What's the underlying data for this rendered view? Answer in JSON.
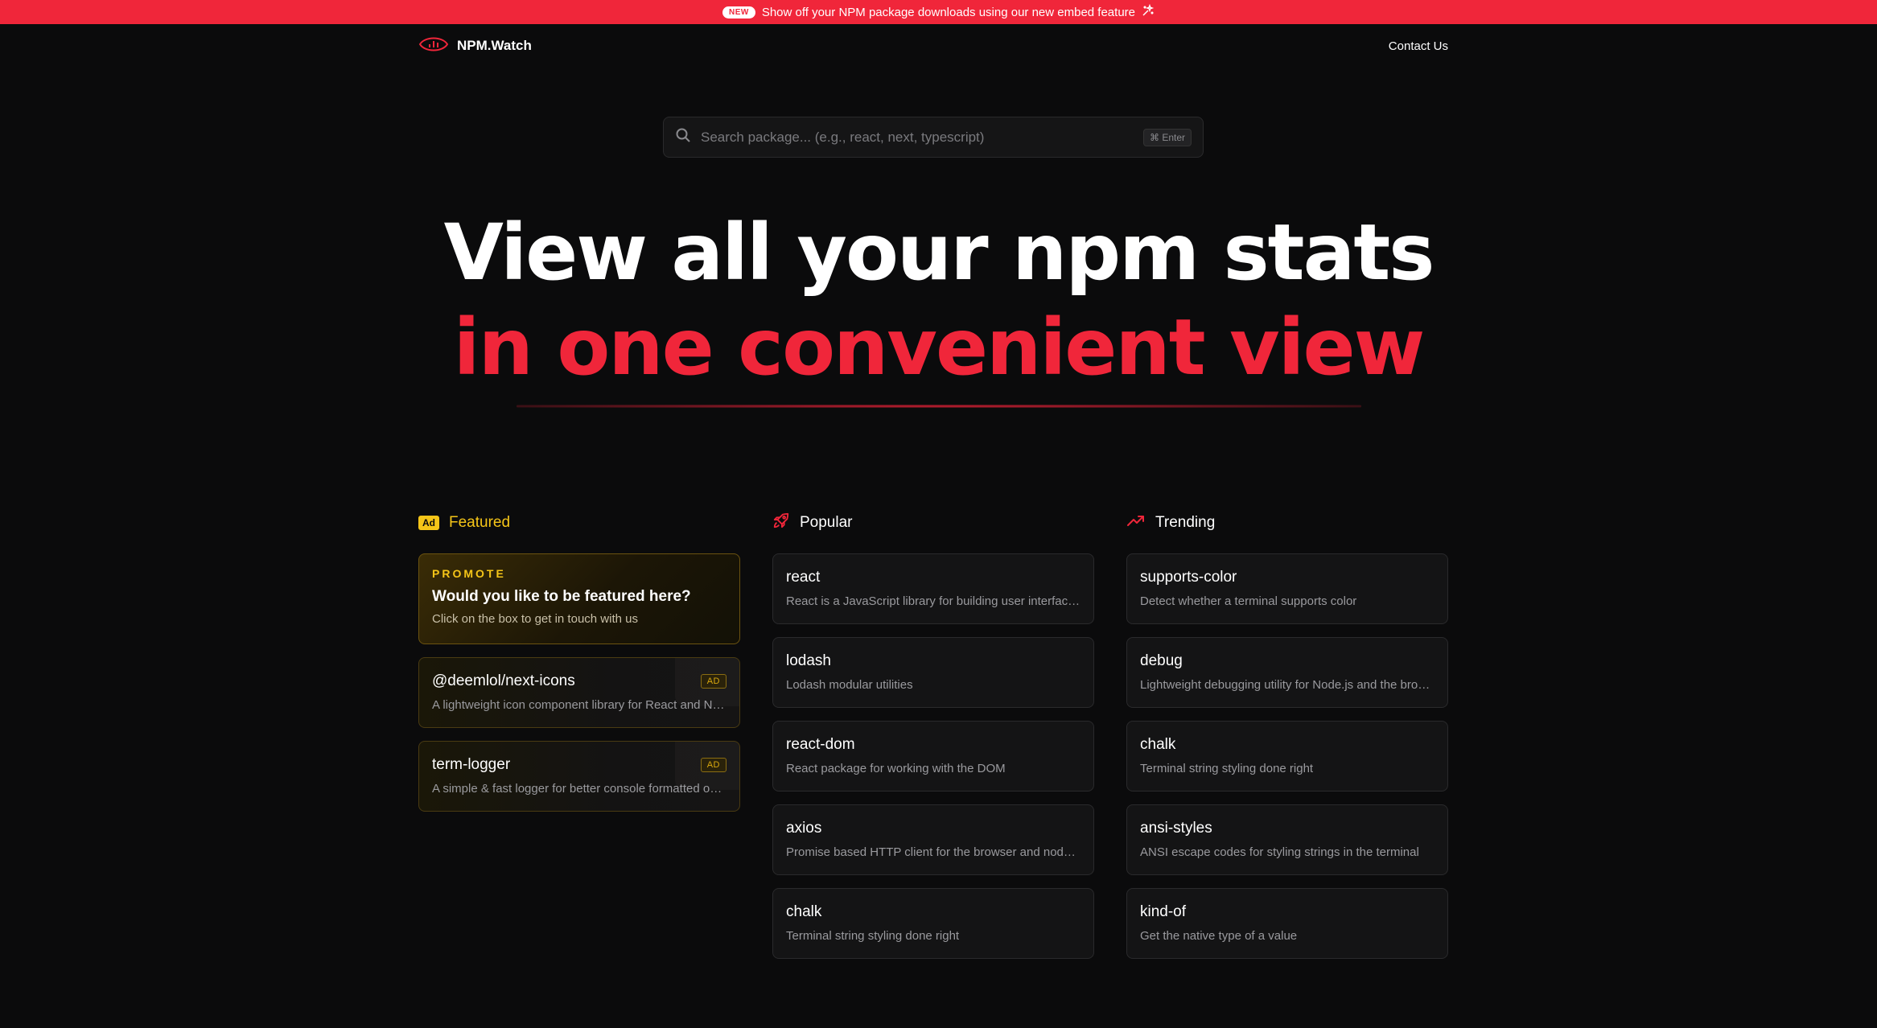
{
  "banner": {
    "badge": "NEW",
    "text": "Show off your NPM package downloads using our new embed feature"
  },
  "nav": {
    "brand": "NPM.Watch",
    "contact": "Contact Us"
  },
  "search": {
    "placeholder": "Search package... (e.g., react, next, typescript)",
    "shortcut": "⌘ Enter"
  },
  "hero": {
    "line1": "View all your npm stats",
    "line2": "in one convenient view"
  },
  "featured": {
    "tag": "Ad",
    "title": "Featured",
    "promo": {
      "kicker": "PROMOTE",
      "question": "Would you like to be featured here?",
      "sub": "Click on the box to get in touch with us"
    },
    "ads": [
      {
        "name": "@deemlol/next-icons",
        "desc": "A lightweight icon component library for React and Next.js",
        "badge": "AD"
      },
      {
        "name": "term-logger",
        "desc": "A simple & fast logger for better console formatted output",
        "badge": "AD"
      }
    ]
  },
  "popular": {
    "title": "Popular",
    "items": [
      {
        "name": "react",
        "desc": "React is a JavaScript library for building user interfaces."
      },
      {
        "name": "lodash",
        "desc": "Lodash modular utilities"
      },
      {
        "name": "react-dom",
        "desc": "React package for working with the DOM"
      },
      {
        "name": "axios",
        "desc": "Promise based HTTP client for the browser and node.js"
      },
      {
        "name": "chalk",
        "desc": "Terminal string styling done right"
      }
    ]
  },
  "trending": {
    "title": "Trending",
    "items": [
      {
        "name": "supports-color",
        "desc": "Detect whether a terminal supports color"
      },
      {
        "name": "debug",
        "desc": "Lightweight debugging utility for Node.js and the browser"
      },
      {
        "name": "chalk",
        "desc": "Terminal string styling done right"
      },
      {
        "name": "ansi-styles",
        "desc": "ANSI escape codes for styling strings in the terminal"
      },
      {
        "name": "kind-of",
        "desc": "Get the native type of a value"
      }
    ]
  },
  "colors": {
    "accent": "#f0263a",
    "gold": "#f5c518",
    "background": "#0b0b0c",
    "card": "#141415"
  },
  "icons": {
    "logo": "eye-chart-icon",
    "sparkle": "sparkle-icon",
    "search": "search-icon",
    "popular": "rocket-icon",
    "trending": "trending-up-icon"
  }
}
